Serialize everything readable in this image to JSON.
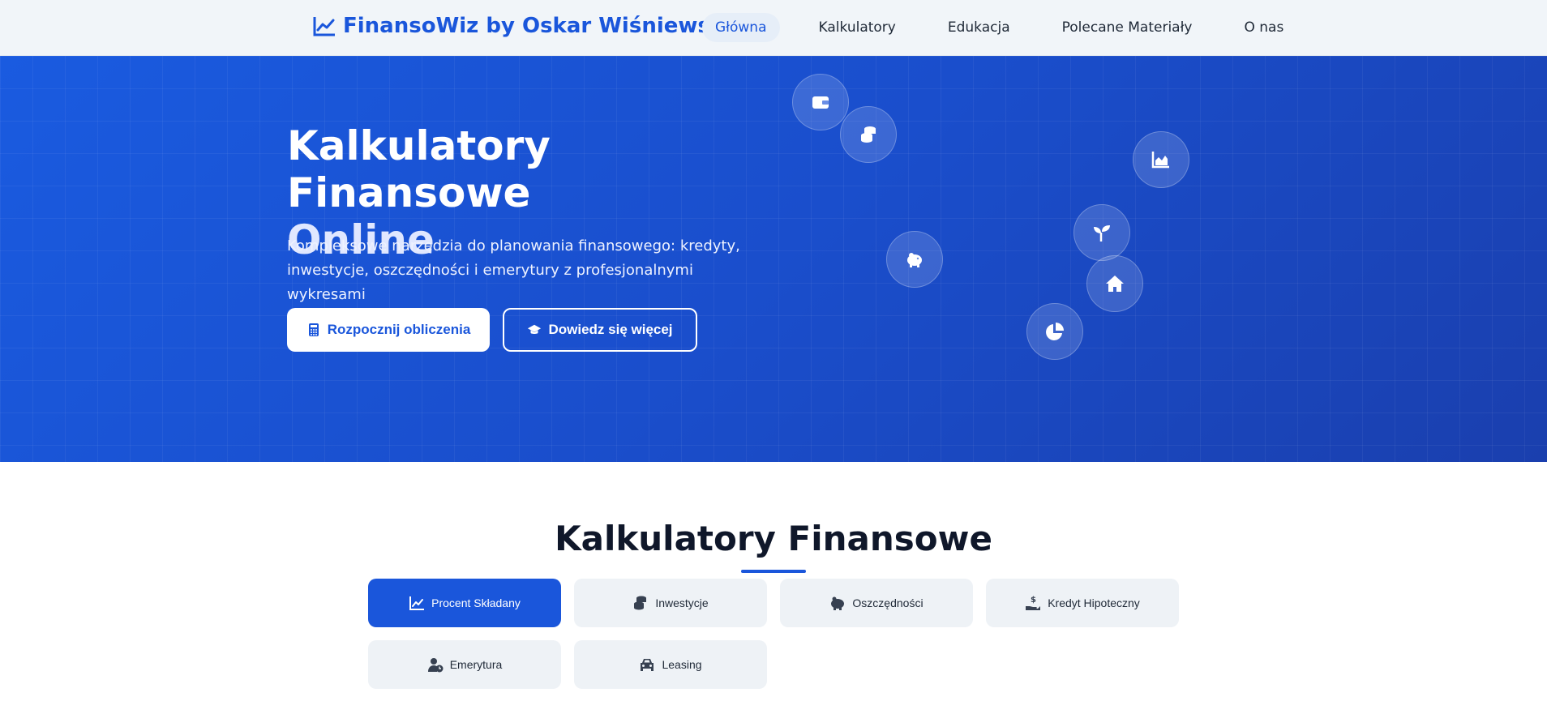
{
  "nav": {
    "brand": "FinansoWiz by Oskar Wiśniewski",
    "links": [
      "Główna",
      "Kalkulatory",
      "Edukacja",
      "Polecane Materiały",
      "O nas"
    ]
  },
  "hero": {
    "title_line1": "Kalkulatory Finansowe",
    "title_line2": "Online",
    "subtitle": "Kompleksowe narzędzia do planowania finansowego: kredyty, inwestycje, oszczędności i emerytury z profesjonalnymi wykresami",
    "primary_button": "Rozpocznij obliczenia",
    "secondary_button": "Dowiedz się więcej",
    "floating_icons": [
      "wallet-icon",
      "coins-icon",
      "chart-area-icon",
      "seedling-icon",
      "piggy-bank-icon",
      "home-icon",
      "pie-chart-icon"
    ]
  },
  "calculators": {
    "title": "Kalkulatory Finansowe",
    "tabs": [
      "Procent Składany",
      "Inwestycje",
      "Oszczędności",
      "Kredyt Hipoteczny",
      "Emerytura",
      "Leasing"
    ]
  },
  "colors": {
    "accent": "#1a56db",
    "hero_bg": "#1a4ecc",
    "tab_bg": "#eef2f6"
  }
}
